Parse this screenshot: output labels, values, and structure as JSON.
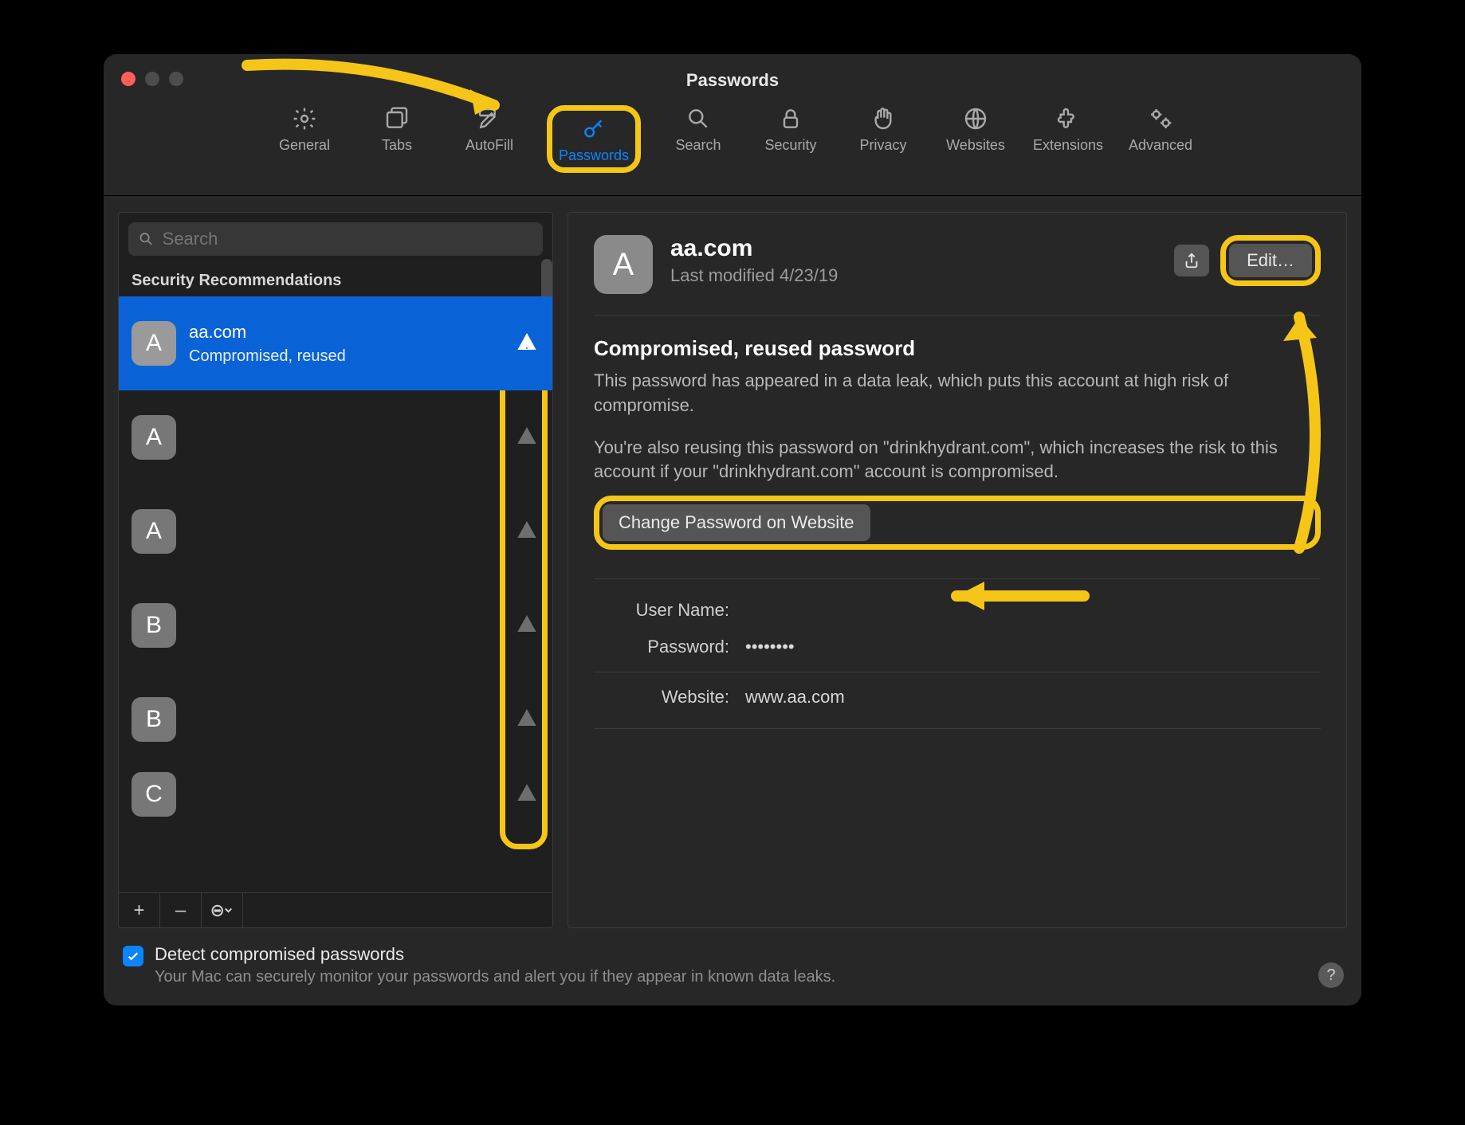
{
  "window": {
    "title": "Passwords"
  },
  "toolbar": {
    "items": [
      {
        "id": "general",
        "label": "General"
      },
      {
        "id": "tabs",
        "label": "Tabs"
      },
      {
        "id": "autofill",
        "label": "AutoFill"
      },
      {
        "id": "passwords",
        "label": "Passwords",
        "active": true
      },
      {
        "id": "search",
        "label": "Search"
      },
      {
        "id": "security",
        "label": "Security"
      },
      {
        "id": "privacy",
        "label": "Privacy"
      },
      {
        "id": "websites",
        "label": "Websites"
      },
      {
        "id": "extensions",
        "label": "Extensions"
      },
      {
        "id": "advanced",
        "label": "Advanced"
      }
    ]
  },
  "sidebar": {
    "search_placeholder": "Search",
    "section_header": "Security Recommendations",
    "rows": [
      {
        "letter": "A",
        "site": "aa.com",
        "subtitle": "Compromised, reused",
        "selected": true
      },
      {
        "letter": "A"
      },
      {
        "letter": "A"
      },
      {
        "letter": "B"
      },
      {
        "letter": "B"
      },
      {
        "letter": "C"
      }
    ],
    "footer": {
      "add": "+",
      "remove": "–",
      "more": "⊙﹀"
    }
  },
  "detail": {
    "avatar_letter": "A",
    "title": "aa.com",
    "modified": "Last modified 4/23/19",
    "share_label": "Share",
    "edit_label": "Edit…",
    "warning_title": "Compromised, reused password",
    "warning_body_1": "This password has appeared in a data leak, which puts this account at high risk of compromise.",
    "warning_body_2": "You're also reusing this password on \"drinkhydrant.com\", which increases the risk to this account if your \"drinkhydrant.com\" account is compromised.",
    "change_button": "Change Password on Website",
    "fields": {
      "username_label": "User Name:",
      "username_value": "",
      "password_label": "Password:",
      "password_value": "••••••••",
      "website_label": "Website:",
      "website_value": "www.aa.com"
    }
  },
  "footer": {
    "checkbox_checked": true,
    "title": "Detect compromised passwords",
    "subtitle": "Your Mac can securely monitor your passwords and alert you if they appear in known data leaks."
  },
  "help_label": "?"
}
